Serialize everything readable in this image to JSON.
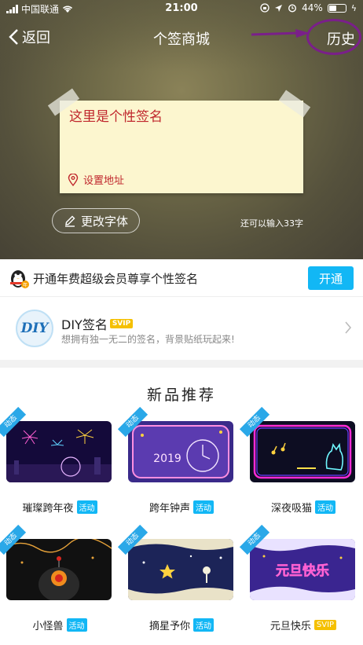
{
  "statusbar": {
    "carrier": "中国联通",
    "time": "21:00",
    "battery": "44%",
    "battery_level": 0.44
  },
  "nav": {
    "back_label": "返回",
    "title": "个签商城",
    "history_label": "历史"
  },
  "editor": {
    "signature_text": "这里是个性签名",
    "location_label": "设置地址",
    "font_button": "更改字体",
    "remaining_text": "还可以输入33字"
  },
  "vip_banner": {
    "text": "开通年费超级会员尊享个性签名",
    "button": "开通"
  },
  "diy": {
    "logo": "DIY",
    "title": "DIY签名",
    "badge": "SVIP",
    "desc": "想拥有独一无二的签名，背景贴纸玩起来!"
  },
  "new_section": {
    "title": "新品推荐",
    "items": [
      {
        "ribbon": "动态",
        "name": "璀璨跨年夜",
        "tag": "活动"
      },
      {
        "ribbon": "动态",
        "name": "跨年钟声",
        "tag": "活动"
      },
      {
        "ribbon": "动态",
        "name": "深夜吸猫",
        "tag": "活动"
      },
      {
        "ribbon": "动态",
        "name": "小怪兽",
        "tag": "活动"
      },
      {
        "ribbon": "动态",
        "name": "摘星予你",
        "tag": "活动"
      },
      {
        "ribbon": "动态",
        "name": "元旦快乐",
        "tag": "SVIP"
      }
    ],
    "thumb6_text": "元旦快乐"
  },
  "colors": {
    "accent": "#12b7f5",
    "note_text": "#c0272d",
    "svip": "#f5c000",
    "annotation": "#7a1f8a"
  }
}
